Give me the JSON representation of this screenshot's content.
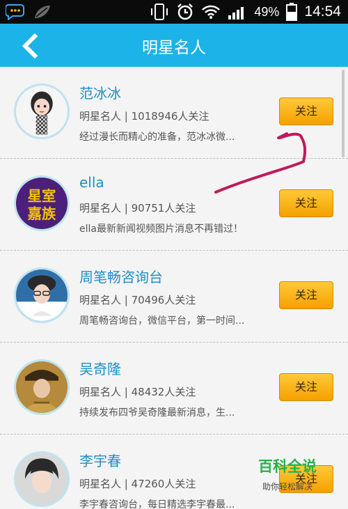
{
  "status_bar": {
    "battery": "49%",
    "time": "14:54"
  },
  "header": {
    "title": "明星名人"
  },
  "items": [
    {
      "name": "范冰冰",
      "category": "明星名人",
      "followers": "1018946人关注",
      "description": "经过漫长而精心的准备，范冰冰微...",
      "follow_label": "关注",
      "avatar_icon": "cartoon-girl-avatar"
    },
    {
      "name": "ella",
      "category": "明星名人",
      "followers": "90751人关注",
      "description": "ella最新新闻视频图片消息不再错过！",
      "follow_label": "关注",
      "avatar_icon": "text-logo-avatar",
      "avatar_text": [
        "星室",
        "嘉族"
      ]
    },
    {
      "name": "周笔畅咨询台",
      "category": "明星名人",
      "followers": "70496人关注",
      "description": "周笔畅咨询台，微信平台，第一时间...",
      "follow_label": "关注",
      "avatar_icon": "person-avatar"
    },
    {
      "name": "吴奇隆",
      "category": "明星名人",
      "followers": "48432人关注",
      "description": "持续发布四爷吴奇隆最新消息，生...",
      "follow_label": "关注",
      "avatar_icon": "person-avatar"
    },
    {
      "name": "李宇春",
      "category": "明星名人",
      "followers": "47260人关注",
      "description": "李宇春咨询台，每日精选李宇春最...",
      "follow_label": "关注",
      "avatar_icon": "person-avatar"
    }
  ],
  "watermark": {
    "title": "百科全说",
    "subtitle": "助你轻松解决"
  },
  "colors": {
    "header": "#1cb3e8",
    "name_text": "#1e8fc6",
    "follow_button": "#f5a000",
    "annotation_arrow": "#c2185b",
    "watermark": "#26b14a"
  }
}
